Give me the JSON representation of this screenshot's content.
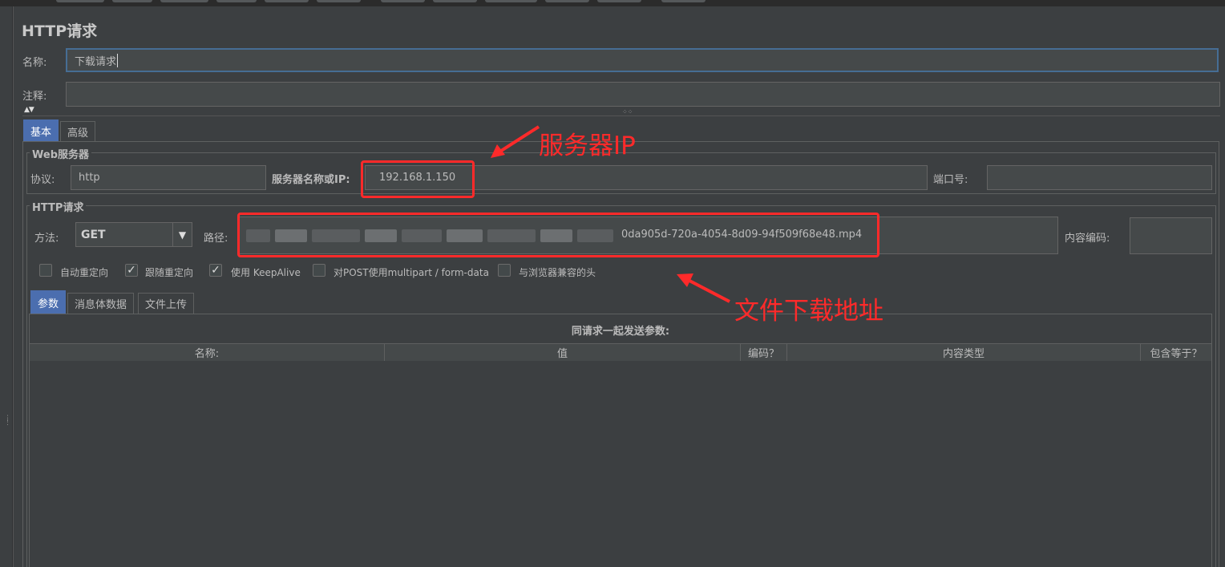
{
  "window": {
    "title": "HTTP请求"
  },
  "name_field": {
    "label": "名称:",
    "value": "下载请求"
  },
  "comment_field": {
    "label": "注释:",
    "value": ""
  },
  "tabs": [
    "基本",
    "高级"
  ],
  "web_server": {
    "group_title": "Web服务器",
    "protocol_label": "协议:",
    "protocol_value": "http",
    "server_label": "服务器名称或IP:",
    "server_value": "192.168.1.150",
    "port_label": "端口号:",
    "port_value": ""
  },
  "http_request": {
    "group_title": "HTTP请求",
    "method_label": "方法:",
    "method_value": "GET",
    "path_label": "路径:",
    "path_value_visible": "0da905d-720a-4054-8d09-94f509f68e48.mp4",
    "encoding_label": "内容编码:",
    "encoding_value": ""
  },
  "checkboxes": [
    {
      "label": "自动重定向",
      "checked": false
    },
    {
      "label": "跟随重定向",
      "checked": true
    },
    {
      "label": "使用 KeepAlive",
      "checked": true
    },
    {
      "label": "对POST使用multipart / form-data",
      "checked": false
    },
    {
      "label": "与浏览器兼容的头",
      "checked": false
    }
  ],
  "sub_tabs": [
    "参数",
    "消息体数据",
    "文件上传"
  ],
  "params": {
    "caption": "同请求一起发送参数:",
    "columns": [
      "名称:",
      "值",
      "编码？",
      "内容类型",
      "包含等于？"
    ],
    "rows": []
  },
  "annotations": {
    "server_ip": "服务器IP",
    "download_url": "文件下载地址"
  },
  "colors": {
    "background": "#3c3f41",
    "field": "#45494a",
    "selected_tab": "#4b6eaf",
    "annotation_red": "#ff2a2a"
  }
}
